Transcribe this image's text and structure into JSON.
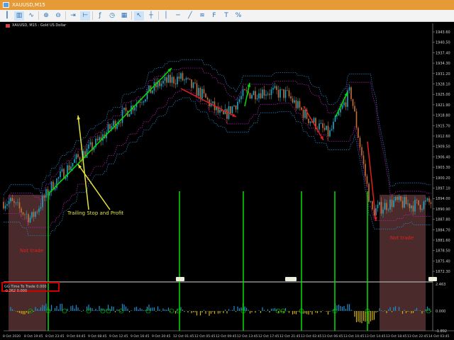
{
  "window": {
    "title": "XAUUSD,M15"
  },
  "toolbar": {
    "icons": [
      "bar-chart-icon",
      "candles-icon",
      "line-chart-icon",
      "zoom-in-icon",
      "zoom-out-icon",
      "autoscroll-icon",
      "chart-shift-icon",
      "indicators-icon",
      "periods-icon",
      "templates-icon",
      "cursor-icon",
      "crosshair-icon",
      "vertical-line-icon",
      "horizontal-line-icon",
      "trendline-icon",
      "channel-icon",
      "fibo-icon",
      "text-icon",
      "shapes-icon"
    ]
  },
  "chart": {
    "symbol_label": "XAUUSD, M15 : Gold US Dollar",
    "price_axis": [
      "1943.60",
      "1940.50",
      "1937.40",
      "1934.30",
      "1931.20",
      "1928.10",
      "1925.00",
      "1921.90",
      "1918.80",
      "1915.70",
      "1912.60",
      "1909.50",
      "1906.40",
      "1903.30",
      "1900.20",
      "1897.10",
      "1894.00",
      "1890.90",
      "1887.80",
      "1884.70",
      "1881.60",
      "1878.50",
      "1875.40",
      "1872.30"
    ],
    "annotation": "Trailing Stop and Profit",
    "not_trade_label": "Not trade",
    "indicator": {
      "label": "GG Time To Trade 0.000 -0.262 0.000",
      "axis": [
        "2.463",
        "0.000",
        "-1.892"
      ]
    },
    "colors": {
      "bull": "#20a8c8",
      "bear": "#c8703a",
      "up_hist": "#1a8fd0",
      "down_hist": "#d0b010",
      "signal": "#00e000",
      "exit": "#e02020",
      "band_outer": "#2a8ad0",
      "band_inner": "#c020c0",
      "not_trade": "#4a2a2a"
    }
  },
  "chart_data": {
    "type": "candlestick",
    "x": [
      "8 Oct 2020",
      "8 Oct 19:45",
      "8 Oct 23:45",
      "9 Oct 04:45",
      "9 Oct 08:45",
      "9 Oct 12:45",
      "9 Oct 16:45",
      "9 Oct 20:45",
      "12 Oct 01:45",
      "12 Oct 05:45",
      "12 Oct 09:45",
      "12 Oct 13:45",
      "12 Oct 17:45",
      "12 Oct 21:45",
      "13 Oct 02:45",
      "13 Oct 06:45",
      "13 Oct 10:45",
      "13 Oct 14:45",
      "13 Oct 18:45",
      "13 Oct 22:45",
      "14 Oct 03:45"
    ],
    "close": [
      1893,
      1888,
      1898,
      1905,
      1910,
      1917,
      1923,
      1928,
      1930,
      1925,
      1918,
      1925,
      1926,
      1925,
      1918,
      1913,
      1926,
      1890,
      1893,
      1892,
      1893
    ],
    "ylim": [
      1869.2,
      1945
    ],
    "grid": false
  }
}
